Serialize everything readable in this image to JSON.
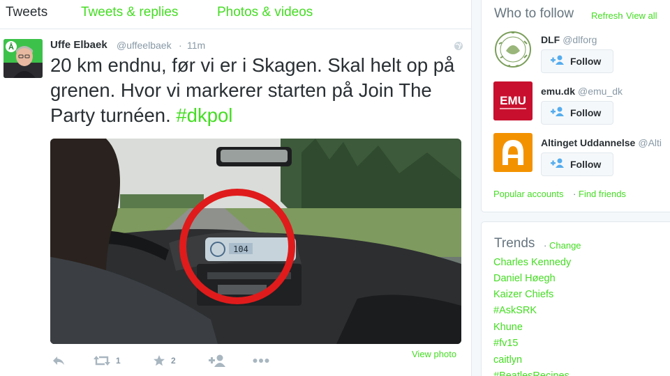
{
  "tabs": {
    "tweets": "Tweets",
    "replies": "Tweets & replies",
    "photos": "Photos & videos"
  },
  "tweet": {
    "author_name": "Uffe Elbaek",
    "author_handle": "@uffeelbaek",
    "separator": "·",
    "time": "11m",
    "text": "20 km endnu, før vi er i Skagen. Skal helt op på grenen. Hvor vi markerer starten på Join The Party turnéen.",
    "hashtag": "#dkpol",
    "view_photo": "View photo",
    "retweet_count": "1",
    "favorite_count": "2",
    "media_speed_readout": "104"
  },
  "who_to_follow": {
    "title": "Who to follow",
    "refresh": "Refresh",
    "dot": "·",
    "view_all": "View all",
    "suggestions": [
      {
        "name": "DLF",
        "handle": "@dlforg",
        "follow": "Follow"
      },
      {
        "name": "emu.dk",
        "handle": "@emu_dk",
        "follow": "Follow",
        "logo_text": "EMU"
      },
      {
        "name": "Altinget Uddannelse",
        "handle": "@Alti",
        "follow": "Follow"
      }
    ],
    "popular": "Popular accounts",
    "find_friends": "Find friends"
  },
  "trends": {
    "title": "Trends",
    "dot": "·",
    "change": "Change",
    "items": [
      "Charles Kennedy",
      "Daniel Høegh",
      "Kaizer Chiefs",
      "#AskSRK",
      "Khune",
      "#fv15",
      "caitlyn",
      "#BeatlesRecipes"
    ]
  },
  "colors": {
    "link": "#44dd22",
    "text": "#292f33",
    "muted": "#8899a6",
    "border": "#e1e8ed",
    "emu_red": "#c8102e",
    "altinget_orange": "#f39200"
  },
  "icons": {
    "reply": "reply-icon",
    "retweet": "retweet-icon",
    "favorite": "star-icon",
    "follow": "follow-person-icon",
    "more": "more-dots-icon",
    "globe": "globe-icon"
  }
}
